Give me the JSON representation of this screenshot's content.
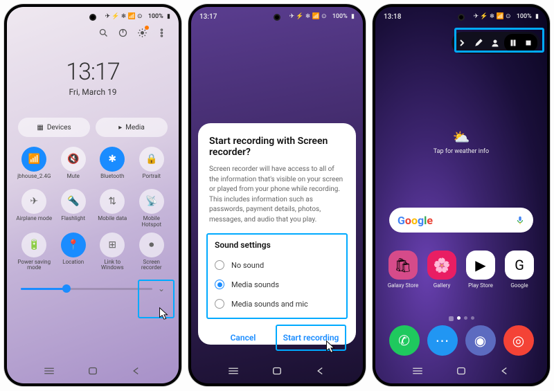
{
  "status": {
    "time1": "",
    "time2": "13:17",
    "time3": "13:18",
    "battery": "100%",
    "icons": "✈ ⚡ ❄ 📶 ⊙"
  },
  "p1": {
    "clock_time": "13:17",
    "clock_date": "Fri, March 19",
    "chip_devices": "Devices",
    "chip_media": "Media",
    "tiles": [
      {
        "label": "jbhouse_2.4G",
        "active": true
      },
      {
        "label": "Mute",
        "active": false
      },
      {
        "label": "Bluetooth",
        "active": true
      },
      {
        "label": "Portrait",
        "active": false
      },
      {
        "label": "Airplane mode",
        "active": false
      },
      {
        "label": "Flashlight",
        "active": false
      },
      {
        "label": "Mobile data",
        "active": false
      },
      {
        "label": "Mobile Hotspot",
        "active": false
      },
      {
        "label": "Power saving mode",
        "active": false
      },
      {
        "label": "Location",
        "active": true
      },
      {
        "label": "Link to Windows",
        "active": false
      },
      {
        "label": "Screen recorder",
        "active": false
      }
    ]
  },
  "p2": {
    "title": "Start recording with Screen recorder?",
    "body": "Screen recorder will have access to all of the information that's visible on your screen or played from your phone while recording. This includes information such as passwords, payment details, photos, messages, and audio that you play.",
    "sound_heading": "Sound settings",
    "opts": [
      "No sound",
      "Media sounds",
      "Media sounds and mic"
    ],
    "selected": 1,
    "cancel": "Cancel",
    "start": "Start recording"
  },
  "p3": {
    "weather": "Tap for weather info",
    "apps_r1": [
      "Galaxy Store",
      "Gallery",
      "Play Store",
      "Google"
    ],
    "dock": [
      "phone",
      "messages",
      "internet",
      "camera"
    ]
  }
}
